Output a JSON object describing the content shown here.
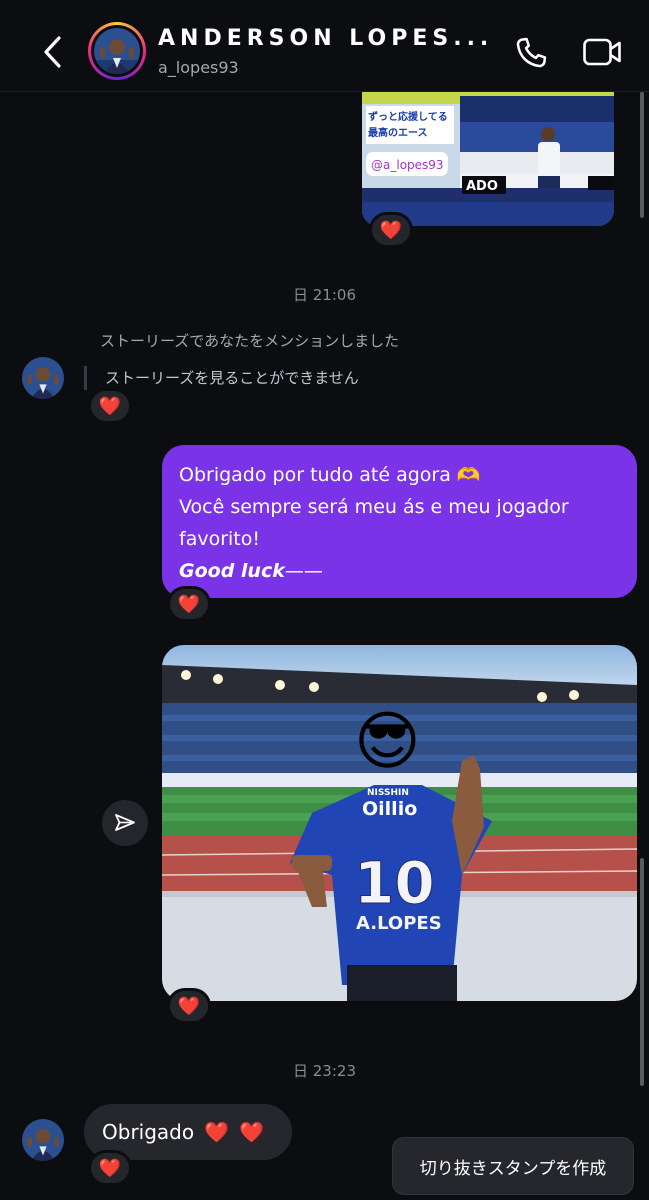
{
  "header": {
    "name": "ANDERSON LOPES...",
    "username": "a_lopes93"
  },
  "story": {
    "caption_line1": "ずっと応援してる",
    "caption_line2": "最高のエース",
    "mention_tag": "@a_lopes93",
    "reaction": "❤️"
  },
  "messages": {
    "timestamp1": "日 21:06",
    "mention_notice": "ストーリーズであなたをメンションしました",
    "story_unavailable": "ストーリーズを見ることができません",
    "reaction1": "❤️",
    "sent_line1": "Obrigado por tudo até agora 🫶",
    "sent_line2": "Você sempre será meu ás e meu jogador",
    "sent_line3": "favorito!",
    "sent_signature": "Good luck",
    "sent_signature_dash": "——",
    "reaction2": "❤️",
    "photo_jersey_sponsor_top": "NISSHIN",
    "photo_jersey_sponsor": "Oillio",
    "photo_jersey_number": "10",
    "photo_jersey_name": "A.LOPES",
    "photo_face_emoji": "😎",
    "reaction3": "❤️",
    "timestamp2": "日 23:23",
    "reply_text": "Obrigado",
    "reply_hearts": "❤️ ❤️",
    "reaction4": "❤️"
  },
  "sticker_button": "切り抜きスタンプを作成",
  "icons": {
    "back": "chevron-left-icon",
    "call": "phone-icon",
    "video": "video-camera-icon",
    "share": "paper-plane-icon"
  },
  "colors": {
    "background": "#0c0d11",
    "sent_bubble": "#7b33e8",
    "received_bubble": "#26272d",
    "heart": "#ff3040"
  }
}
